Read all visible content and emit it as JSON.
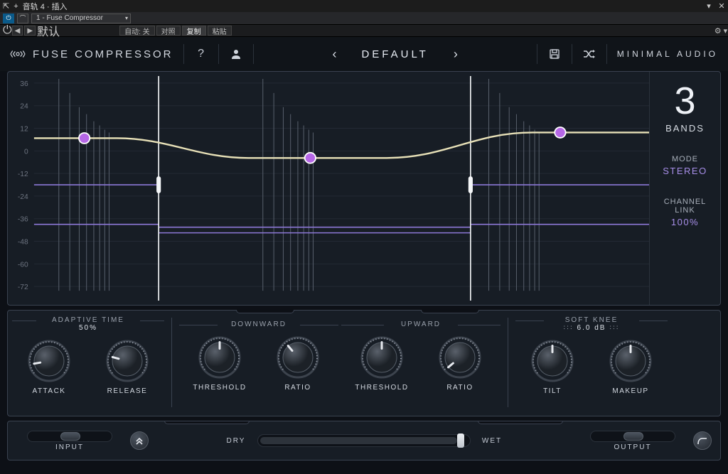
{
  "host": {
    "window_title": "音轨 4 · 插入",
    "plugin_slot": "1 - Fuse Compressor",
    "power_btn": "⏻",
    "nav_prev": "◀",
    "nav_next": "▶",
    "preset_drop": "默认",
    "auto_label": "自动:",
    "auto_state": "关",
    "tab_compare": "对照",
    "tab_copy": "复制",
    "tab_paste": "粘贴"
  },
  "header": {
    "plugin_title": "FUSE COMPRESSOR",
    "preset_name": "DEFAULT",
    "brand": "MINIMAL AUDIO"
  },
  "side": {
    "bands_value": "3",
    "bands_label": "BANDS",
    "mode_label": "MODE",
    "mode_value": "STEREO",
    "link_label_1": "CHANNEL",
    "link_label_2": "LINK",
    "link_value": "100%"
  },
  "graph": {
    "y_ticks": [
      "36",
      "24",
      "12",
      "0",
      "-12",
      "-24",
      "-36",
      "-48",
      "-60",
      "-72"
    ]
  },
  "knob_groups": {
    "adaptive": {
      "title": "ADAPTIVE TIME",
      "value": "50%",
      "knobs": [
        "ATTACK",
        "RELEASE"
      ]
    },
    "downward": {
      "title": "DOWNWARD",
      "knobs": [
        "THRESHOLD",
        "RATIO"
      ]
    },
    "upward": {
      "title": "UPWARD",
      "knobs": [
        "THRESHOLD",
        "RATIO"
      ]
    },
    "right": {
      "title": "SOFT KNEE",
      "value": "6.0 dB",
      "knobs": [
        "TILT",
        "MAKEUP"
      ]
    }
  },
  "bottom": {
    "input_label": "INPUT",
    "output_label": "OUTPUT",
    "dry_label": "DRY",
    "wet_label": "WET"
  }
}
